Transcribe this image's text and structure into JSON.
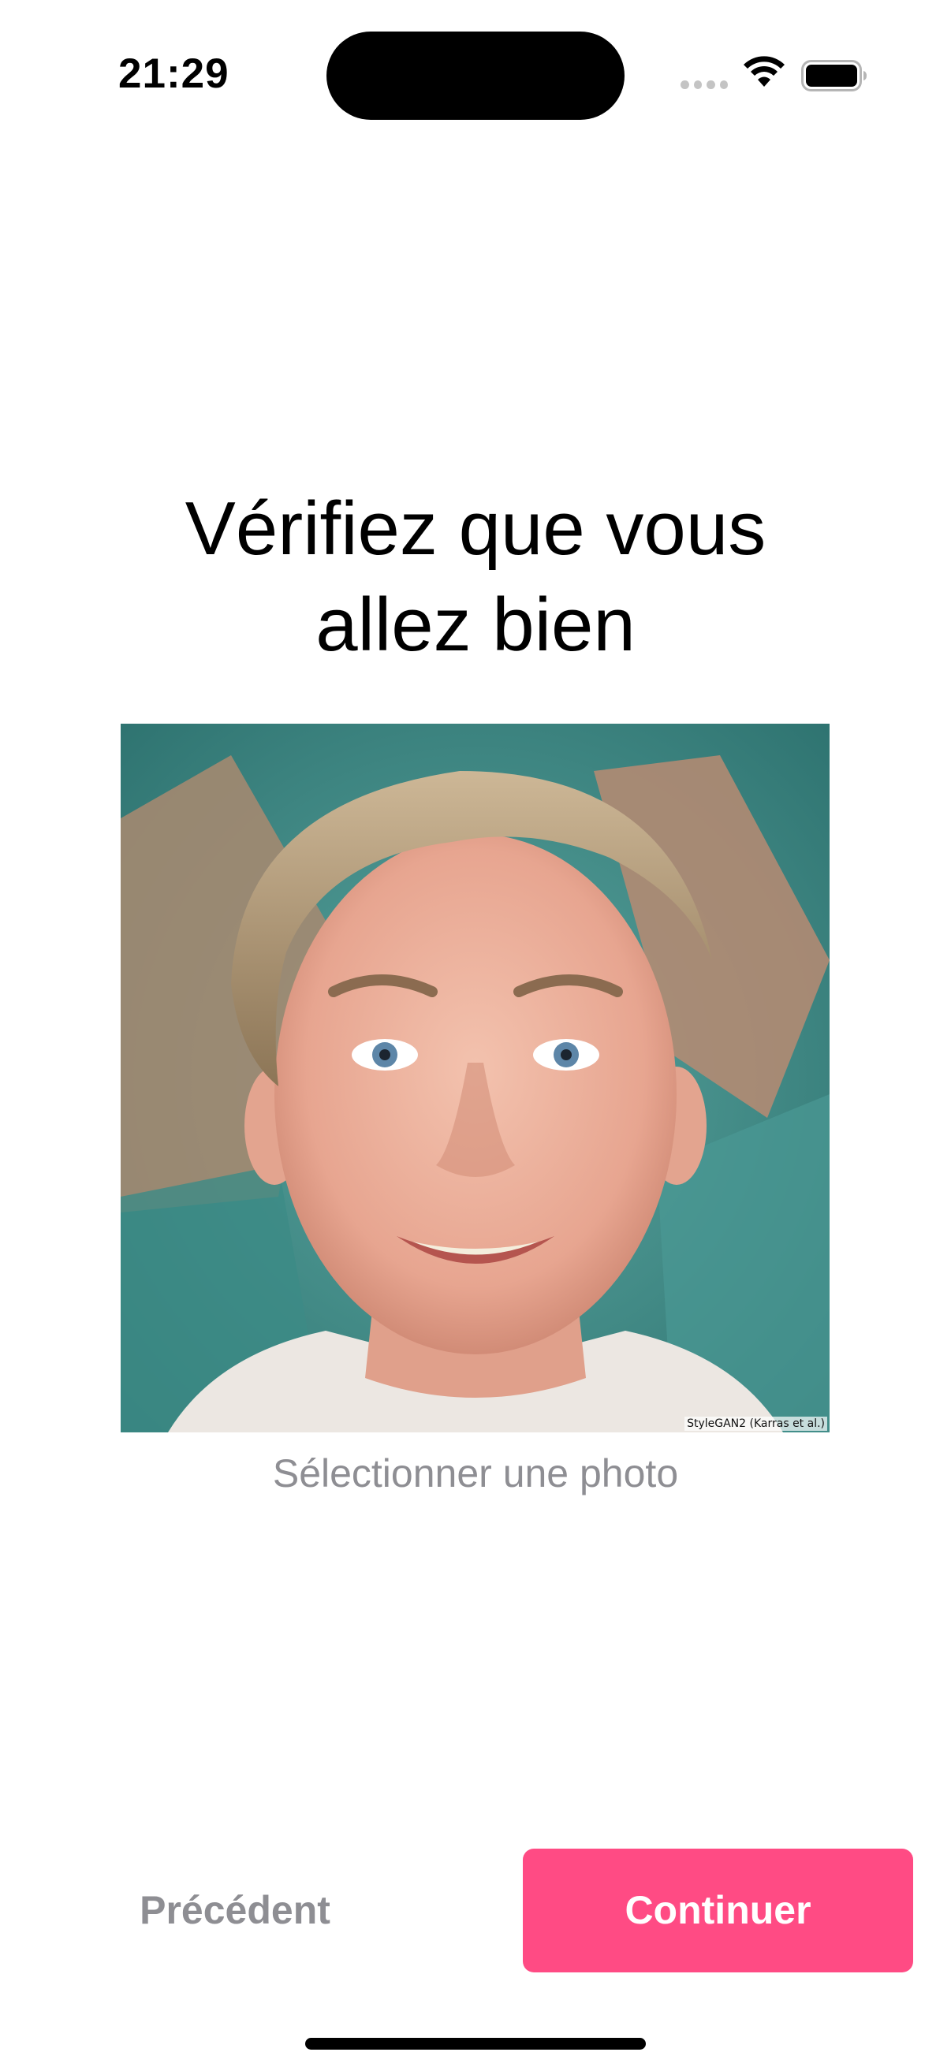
{
  "status_bar": {
    "time": "21:29",
    "icons": [
      "cellular-signal-icon",
      "wifi-icon",
      "battery-icon"
    ]
  },
  "page": {
    "title_line_1": "Vérifiez que vous",
    "title_line_2": "allez bien"
  },
  "photo": {
    "description_icon": "profile-photo",
    "credit": "StyleGAN2 (Karras et al.)"
  },
  "select_photo_label": "Sélectionner une photo",
  "buttons": {
    "previous_label": "Précédent",
    "continue_label": "Continuer"
  },
  "colors": {
    "accent": "#ff4b84",
    "secondary_text": "#8e8e93",
    "background": "#ffffff"
  }
}
